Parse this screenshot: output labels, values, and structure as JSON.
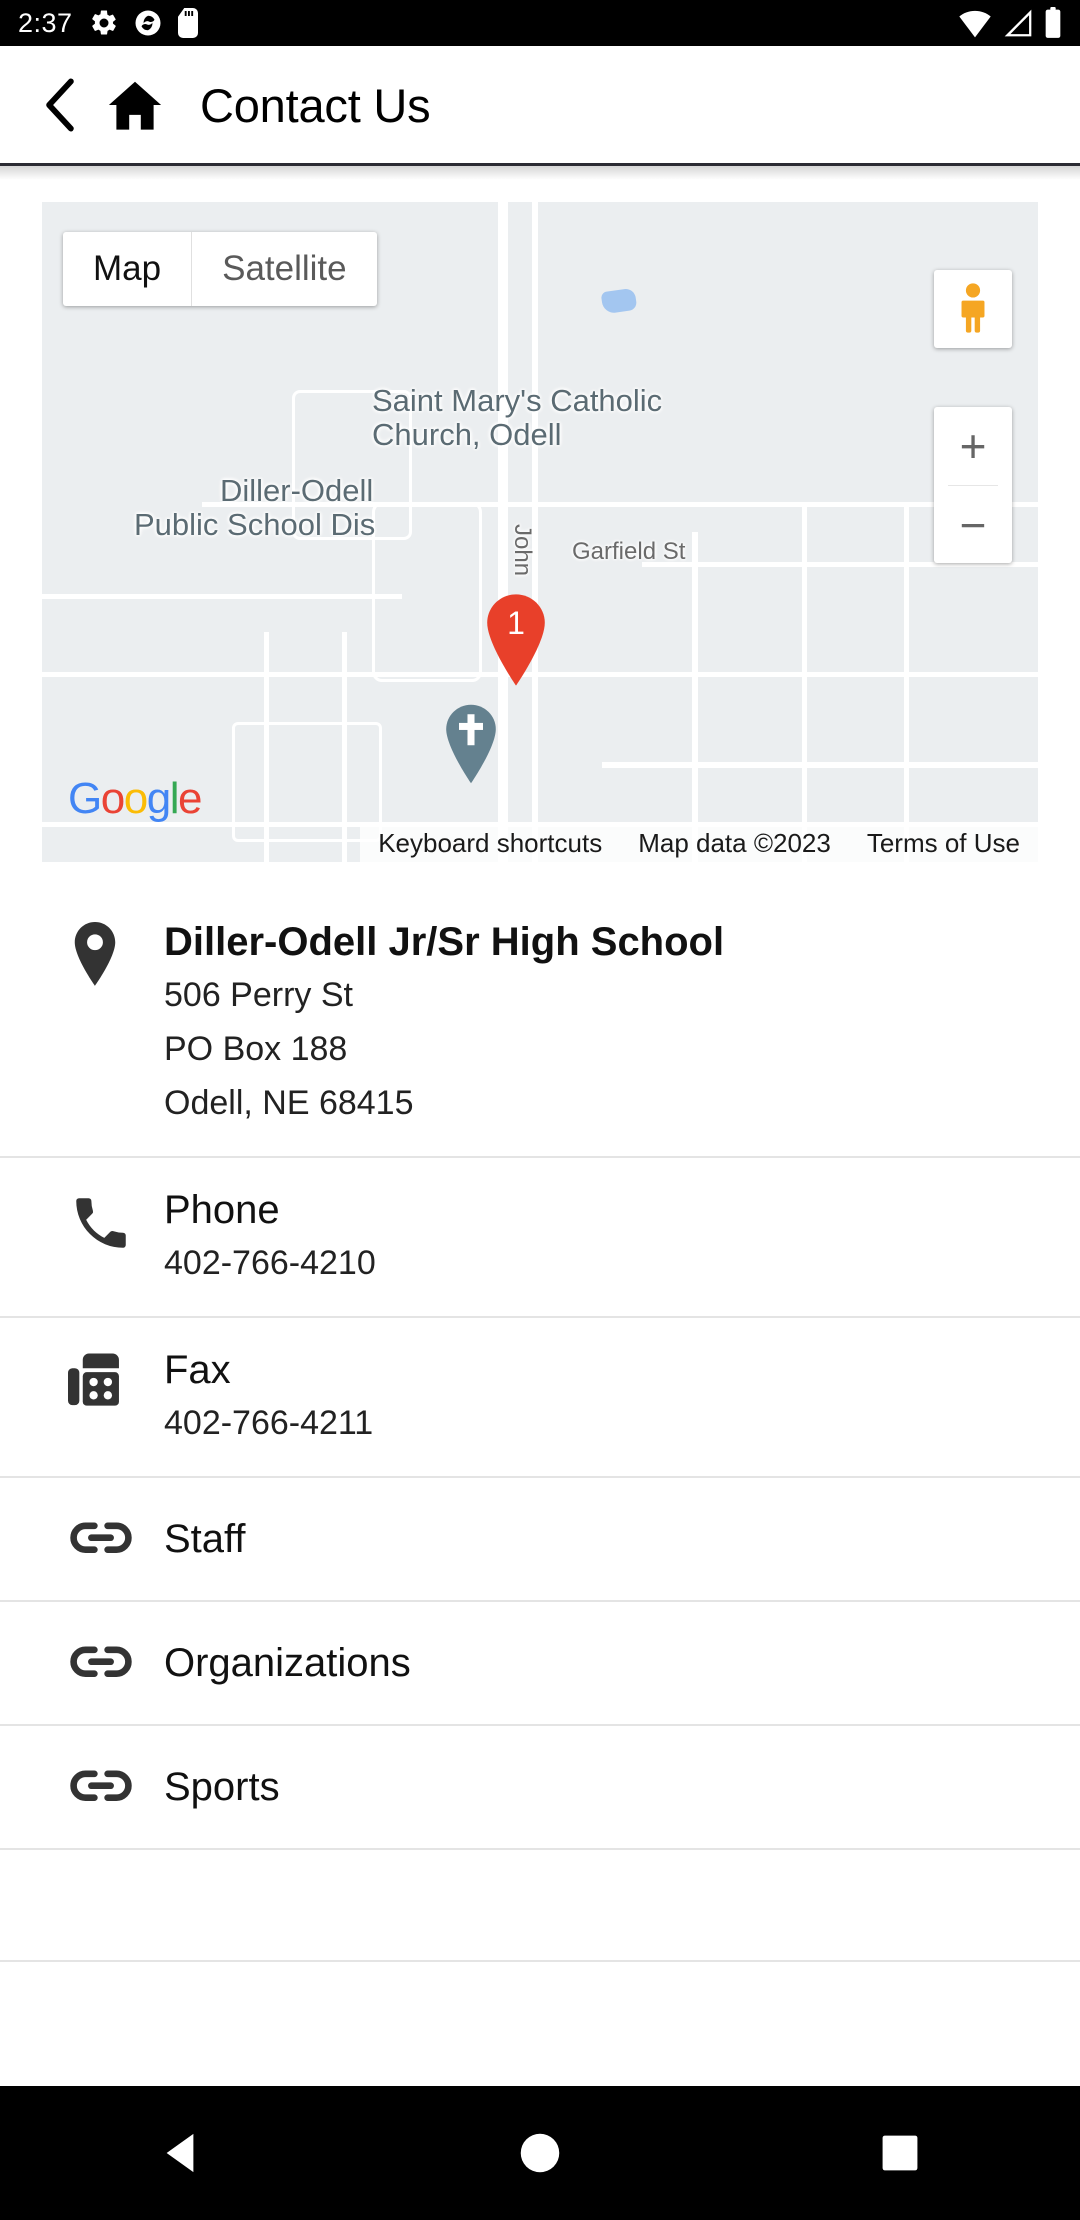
{
  "statusbar": {
    "time": "2:37",
    "left_icons": [
      "settings-gear-icon",
      "disc-icon",
      "sd-card-icon"
    ],
    "right_icons": [
      "wifi-icon",
      "cellular-signal-icon",
      "battery-icon"
    ]
  },
  "appbar": {
    "back_icon": "back-chevron-icon",
    "home_icon": "home-icon",
    "title": "Contact Us"
  },
  "map": {
    "type_control": {
      "map_label": "Map",
      "satellite_label": "Satellite",
      "selected": "Map"
    },
    "pegman_icon": "street-view-pegman-icon",
    "zoom_in_label": "+",
    "zoom_out_label": "−",
    "markers": [
      {
        "name": "numbered-marker",
        "label": "1",
        "color": "#e8402a"
      },
      {
        "name": "church-poi-marker",
        "label": "",
        "color": "#64818f"
      }
    ],
    "poi_labels": [
      "Saint Mary's Catholic",
      "Church, Odell",
      "Diller-Odell",
      "Public School Dis"
    ],
    "street_labels": [
      "Garfield St",
      "John"
    ],
    "logo": {
      "letters": [
        {
          "char": "G",
          "color": "#4285F4"
        },
        {
          "char": "o",
          "color": "#EA4335"
        },
        {
          "char": "o",
          "color": "#FBBC05"
        },
        {
          "char": "g",
          "color": "#4285F4"
        },
        {
          "char": "l",
          "color": "#34A853"
        },
        {
          "char": "e",
          "color": "#EA4335"
        }
      ]
    },
    "attribution": {
      "keyboard_shortcuts": "Keyboard shortcuts",
      "map_data": "Map data ©2023",
      "terms": "Terms of Use"
    }
  },
  "contact": {
    "address_row": {
      "icon": "location-pin-icon",
      "title": "Diller-Odell Jr/Sr High School",
      "lines": [
        "506 Perry St",
        "PO Box 188",
        "Odell, NE  68415"
      ]
    },
    "phone_row": {
      "icon": "phone-icon",
      "title": "Phone",
      "value": "402-766-4210"
    },
    "fax_row": {
      "icon": "fax-icon",
      "title": "Fax",
      "value": "402-766-4211"
    },
    "link_rows": [
      {
        "icon": "link-chain-icon",
        "label": "Staff"
      },
      {
        "icon": "link-chain-icon",
        "label": "Organizations"
      },
      {
        "icon": "link-chain-icon",
        "label": "Sports"
      }
    ]
  },
  "navbar": {
    "back_label": "back-triangle-icon",
    "home_label": "home-circle-icon",
    "recents_label": "recents-square-icon"
  }
}
